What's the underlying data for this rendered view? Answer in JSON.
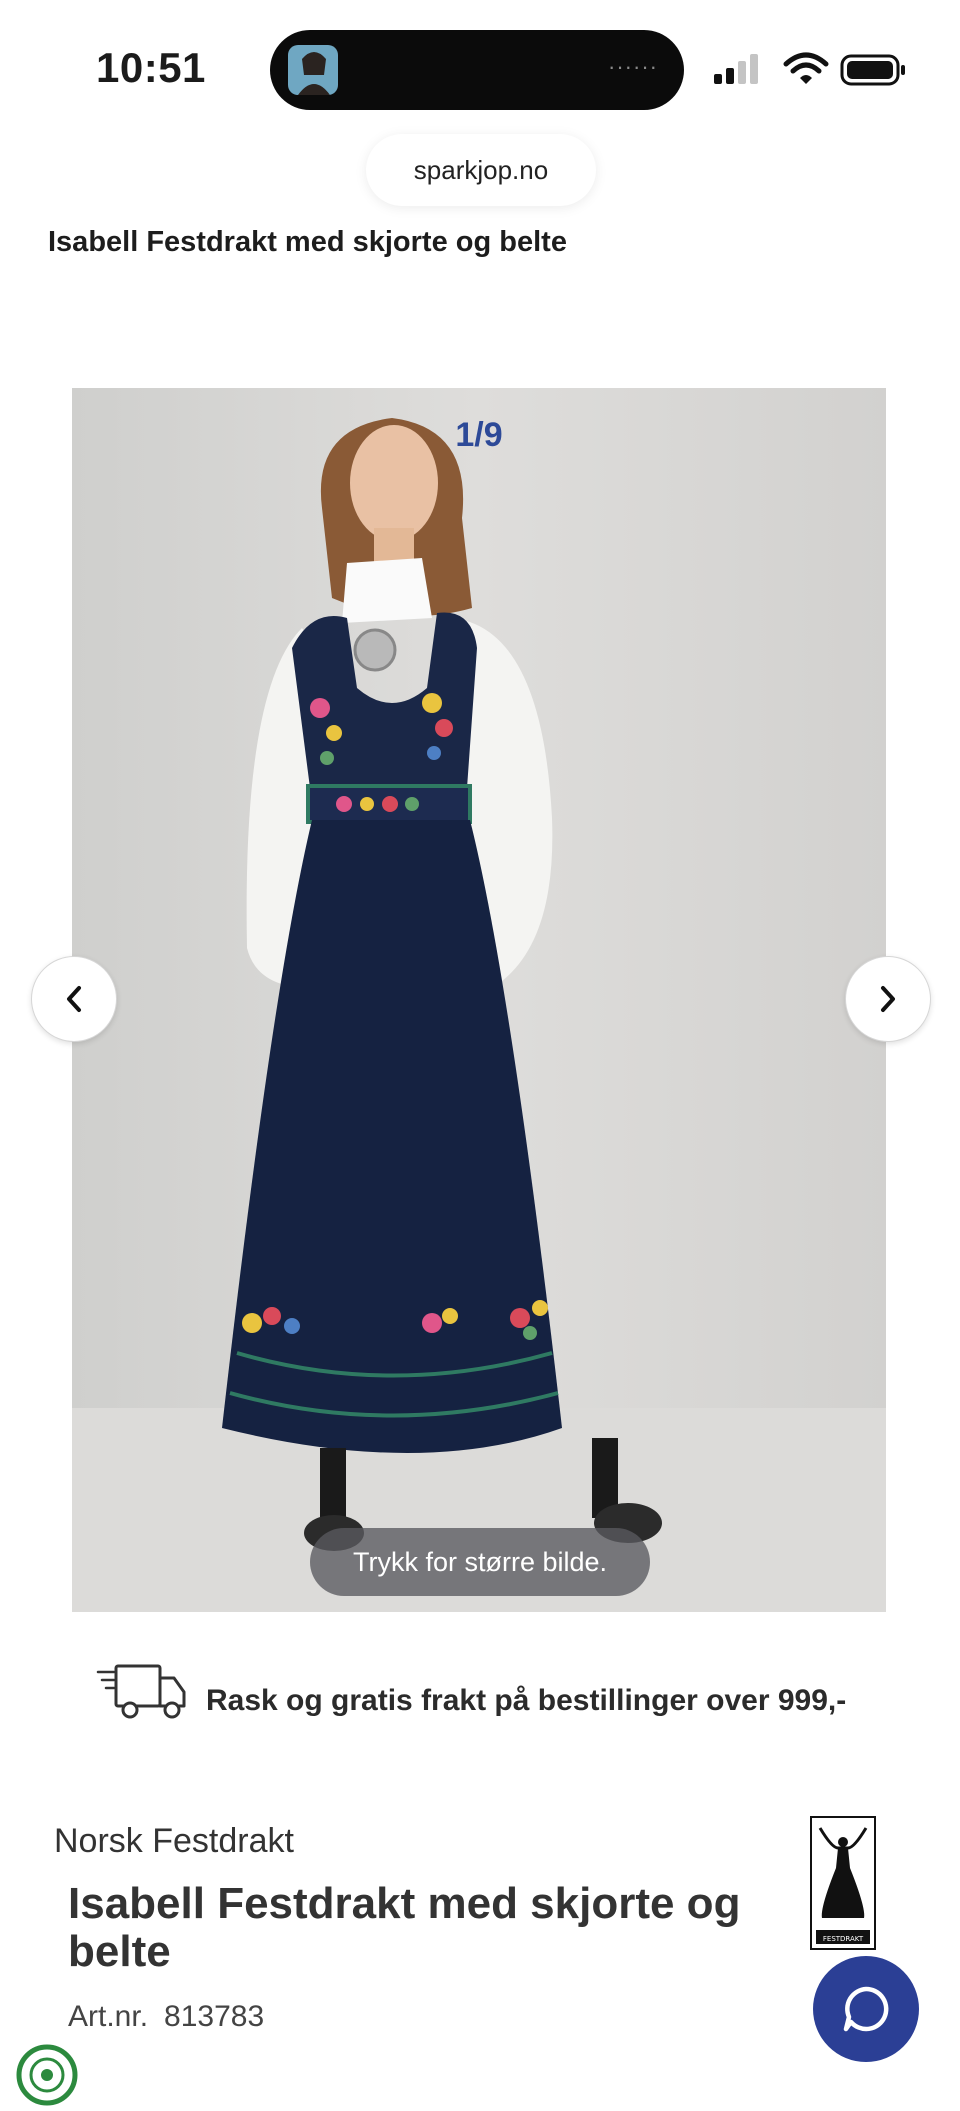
{
  "status_bar": {
    "time": "10:51",
    "island_dots": "······"
  },
  "browser": {
    "url": "sparkjop.no"
  },
  "header": {
    "title": "Isabell Festdrakt med skjorte og belte"
  },
  "gallery": {
    "counter": "1/9",
    "hint": "Trykk for større bilde.",
    "prev_icon": "chevron-left-icon",
    "next_icon": "chevron-right-icon"
  },
  "shipping": {
    "icon": "delivery-truck-icon",
    "text": "Rask og gratis frakt på bestillinger over 999,-"
  },
  "product": {
    "brand": "Norsk Festdrakt",
    "title": "Isabell Festdrakt med skjorte og belte",
    "art_label": "Art.nr.",
    "art_number": "813783",
    "brand_logo_text": "FESTDRAKT"
  },
  "chat": {
    "icon": "chat-bubble-icon"
  },
  "colors": {
    "accent": "#2b3f95",
    "counter": "#2d4a98",
    "dress": "#152241",
    "background": "#d9d8d6"
  }
}
